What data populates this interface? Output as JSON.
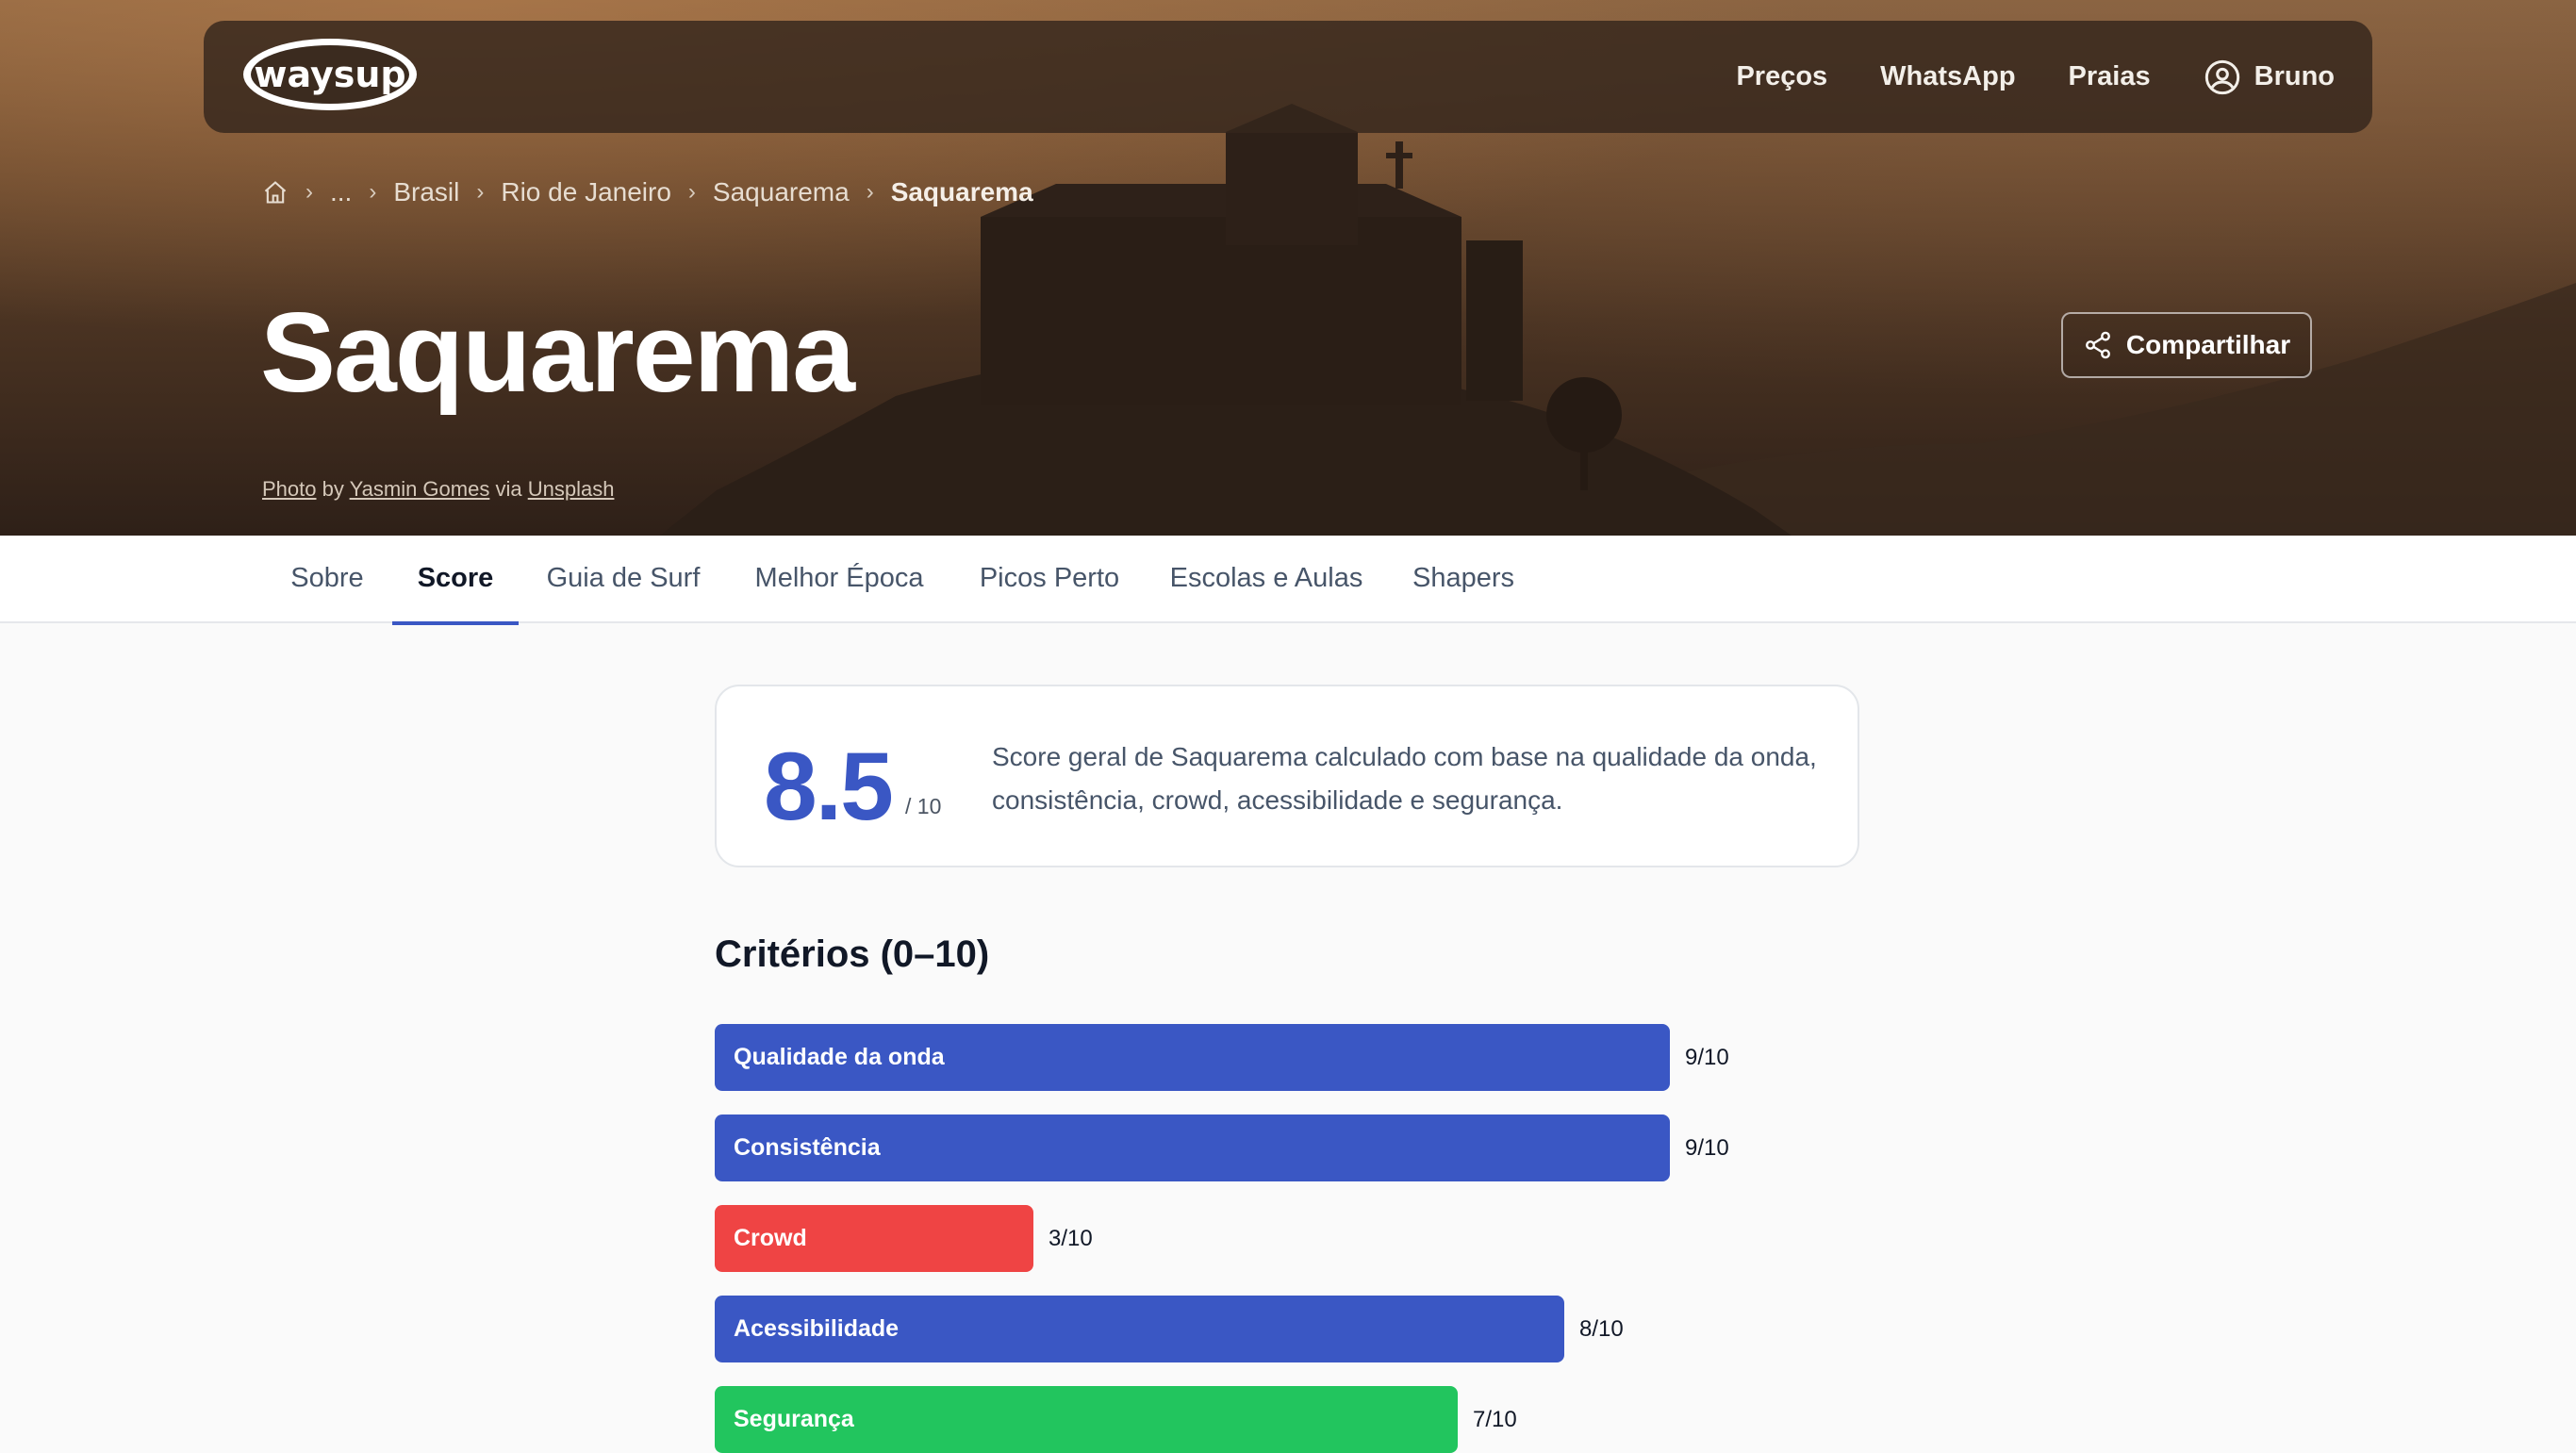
{
  "navbar": {
    "logo_text": "waysup",
    "links": [
      "Preços",
      "WhatsApp",
      "Praias"
    ],
    "user_name": "Bruno"
  },
  "breadcrumb": {
    "ellipsis": "...",
    "items": [
      "Brasil",
      "Rio de Janeiro",
      "Saquarema"
    ],
    "current": "Saquarema"
  },
  "hero": {
    "title": "Saquarema",
    "share_label": "Compartilhar",
    "credit": {
      "photo": "Photo",
      "by": "by",
      "author": "Yasmin Gomes",
      "via": "via",
      "source": "Unsplash"
    }
  },
  "tabs": [
    "Sobre",
    "Score",
    "Guia de Surf",
    "Melhor Época",
    "Picos Perto",
    "Escolas e Aulas",
    "Shapers"
  ],
  "active_tab": "Score",
  "score": {
    "value": "8.5",
    "max_label": "/ 10",
    "description": "Score geral de Saquarema calculado com base na qualidade da onda, consistência, crowd, acessibilidade e segurança."
  },
  "criteria": {
    "title": "Critérios (0–10)",
    "max": 10,
    "items": [
      {
        "label": "Qualidade da onda",
        "score": 9,
        "display": "9/10",
        "color": "#3a57c4"
      },
      {
        "label": "Consistência",
        "score": 9,
        "display": "9/10",
        "color": "#3a57c4"
      },
      {
        "label": "Crowd",
        "score": 3,
        "display": "3/10",
        "color": "#ef4444"
      },
      {
        "label": "Acessibilidade",
        "score": 8,
        "display": "8/10",
        "color": "#3a57c4"
      },
      {
        "label": "Segurança",
        "score": 7,
        "display": "7/10",
        "color": "#22c55e"
      }
    ]
  },
  "colors": {
    "accent": "#3a57c4",
    "danger": "#ef4444",
    "success": "#22c55e"
  }
}
